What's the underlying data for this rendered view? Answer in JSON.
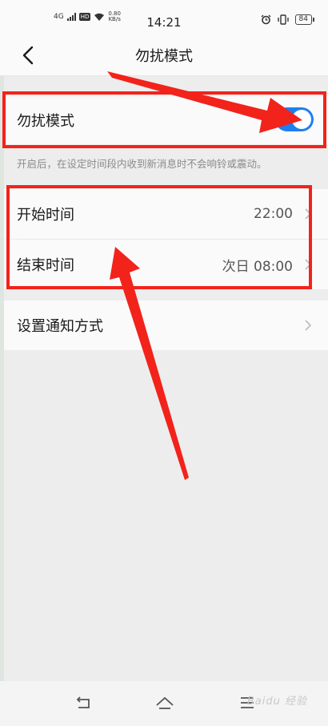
{
  "status_bar": {
    "network": "4G",
    "hd_badge": "HD",
    "speed_value": "0.80",
    "speed_unit": "KB/s",
    "time": "14:21",
    "battery": "84"
  },
  "nav": {
    "title": "勿扰模式"
  },
  "dnd": {
    "label": "勿扰模式",
    "enabled": true,
    "description": "开启后，在设定时间段内收到新消息时不会响铃或震动。"
  },
  "schedule": {
    "start_label": "开始时间",
    "start_value": "22:00",
    "end_label": "结束时间",
    "end_value": "次日 08:00"
  },
  "notify": {
    "label": "设置通知方式"
  },
  "watermark": "Baidu 经验",
  "colors": {
    "accent": "#1f7ef0",
    "annotation": "#f2231b"
  }
}
